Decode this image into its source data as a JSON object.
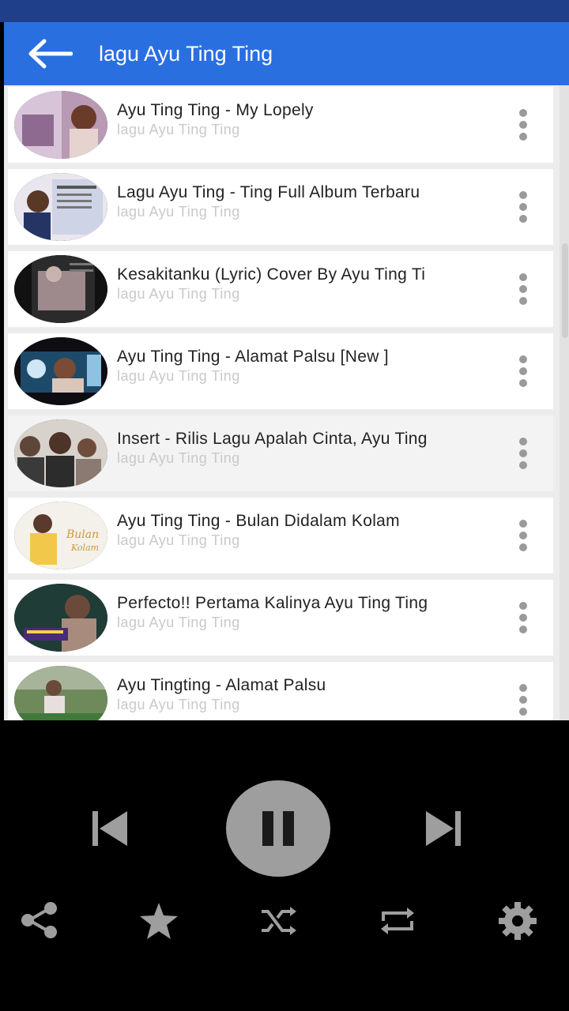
{
  "app_bar": {
    "title": "lagu Ayu Ting Ting"
  },
  "songs": [
    {
      "title": "Ayu Ting Ting - My Lopely",
      "subtitle": "lagu Ayu Ting Ting"
    },
    {
      "title": "Lagu Ayu Ting - Ting Full Album Terbaru",
      "subtitle": "lagu Ayu Ting Ting"
    },
    {
      "title": "Kesakitanku (Lyric) Cover By Ayu Ting Ti",
      "subtitle": "lagu Ayu Ting Ting"
    },
    {
      "title": "Ayu Ting Ting - Alamat Palsu [New ]",
      "subtitle": "lagu Ayu Ting Ting"
    },
    {
      "title": "Insert - Rilis Lagu Apalah Cinta, Ayu Ting",
      "subtitle": "lagu Ayu Ting Ting"
    },
    {
      "title": "Ayu Ting Ting - Bulan Didalam Kolam",
      "subtitle": "lagu Ayu Ting Ting"
    },
    {
      "title": "Perfecto!! Pertama Kalinya Ayu Ting Ting",
      "subtitle": "lagu Ayu Ting Ting"
    },
    {
      "title": "Ayu Tingting - Alamat Palsu",
      "subtitle": "lagu Ayu Ting Ting"
    }
  ],
  "player": {
    "state": "playing",
    "icons": [
      "skip-previous-icon",
      "pause-icon",
      "skip-next-icon",
      "share-icon",
      "star-icon",
      "shuffle-icon",
      "repeat-icon",
      "settings-icon"
    ]
  },
  "colors": {
    "status_bar": "#1f3f8a",
    "app_bar": "#2a6fe0",
    "player_bg": "#000000",
    "control_gray": "#9e9e9e"
  }
}
